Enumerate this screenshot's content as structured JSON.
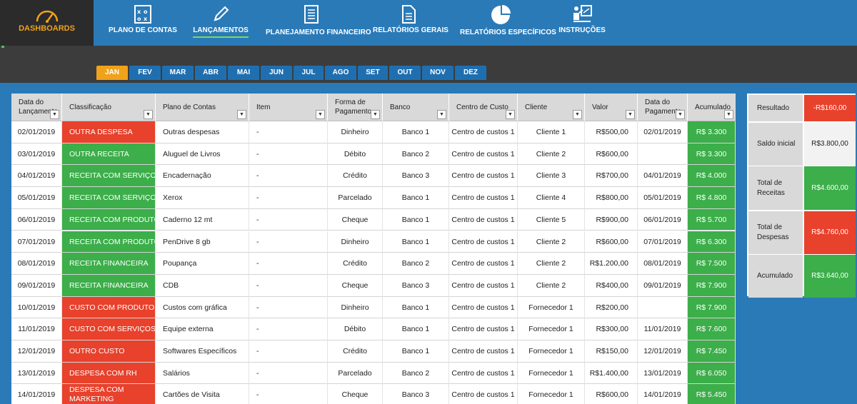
{
  "nav": {
    "dashboards": "DASHBOARDS",
    "items": [
      {
        "label": "PLANO DE CONTAS",
        "icon": "chalkboard-icon"
      },
      {
        "label": "LANÇAMENTOS",
        "icon": "pencil-icon"
      },
      {
        "label": "PLANEJAMENTO FINANCEIRO",
        "icon": "checklist-icon"
      },
      {
        "label": "RELATÓRIOS GERAIS",
        "icon": "document-icon"
      },
      {
        "label": "RELATÓRIOS ESPECÍFICOS",
        "icon": "pie-chart-icon"
      },
      {
        "label": "INSTRUÇÕES",
        "icon": "presenter-icon"
      }
    ],
    "active": "LANÇAMENTOS"
  },
  "months": [
    "JAN",
    "FEV",
    "MAR",
    "ABR",
    "MAI",
    "JUN",
    "JUL",
    "AGO",
    "SET",
    "OUT",
    "NOV",
    "DEZ"
  ],
  "active_month": "JAN",
  "table": {
    "headers": [
      "Data do Lançamento",
      "Classificação",
      "Plano de Contas",
      "Item",
      "Forma de Pagamento",
      "Banco",
      "Centro de Custo",
      "Cliente",
      "Valor",
      "Data do Pagamento",
      "Acumulado"
    ],
    "rows": [
      {
        "data": "02/01/2019",
        "classificacao": "OUTRA DESPESA",
        "tipo": "despesa",
        "plano": "Outras despesas",
        "item": "-",
        "forma": "Dinheiro",
        "banco": "Banco 1",
        "centro": "Centro de custos 1",
        "cliente": "Cliente 1",
        "valor": "R$500,00",
        "pagamento": "02/01/2019",
        "acumulado": "R$ 3.300"
      },
      {
        "data": "03/01/2019",
        "classificacao": "OUTRA RECEITA",
        "tipo": "receita",
        "plano": "Aluguel de Livros",
        "item": "-",
        "forma": "Débito",
        "banco": "Banco 2",
        "centro": "Centro de custos 1",
        "cliente": "Cliente 2",
        "valor": "R$600,00",
        "pagamento": "",
        "acumulado": "R$ 3.300"
      },
      {
        "data": "04/01/2019",
        "classificacao": "RECEITA COM SERVIÇOS",
        "tipo": "receita",
        "plano": "Encadernação",
        "item": "-",
        "forma": "Crédito",
        "banco": "Banco 3",
        "centro": "Centro de custos 1",
        "cliente": "Cliente 3",
        "valor": "R$700,00",
        "pagamento": "04/01/2019",
        "acumulado": "R$ 4.000"
      },
      {
        "data": "05/01/2019",
        "classificacao": "RECEITA COM SERVIÇOS",
        "tipo": "receita",
        "plano": "Xerox",
        "item": "-",
        "forma": "Parcelado",
        "banco": "Banco 1",
        "centro": "Centro de custos 1",
        "cliente": "Cliente 4",
        "valor": "R$800,00",
        "pagamento": "05/01/2019",
        "acumulado": "R$ 4.800"
      },
      {
        "data": "06/01/2019",
        "classificacao": "RECEITA COM PRODUTOS",
        "tipo": "receita",
        "plano": "Caderno 12 mt",
        "item": "-",
        "forma": "Cheque",
        "banco": "Banco 1",
        "centro": "Centro de custos 1",
        "cliente": "Cliente 5",
        "valor": "R$900,00",
        "pagamento": "06/01/2019",
        "acumulado": "R$ 5.700"
      },
      {
        "data": "07/01/2019",
        "classificacao": "RECEITA COM PRODUTOS",
        "tipo": "receita",
        "plano": "PenDrive 8 gb",
        "item": "-",
        "forma": "Dinheiro",
        "banco": "Banco 1",
        "centro": "Centro de custos 1",
        "cliente": "Cliente 2",
        "valor": "R$600,00",
        "pagamento": "07/01/2019",
        "acumulado": "R$ 6.300"
      },
      {
        "data": "08/01/2019",
        "classificacao": "RECEITA FINANCEIRA",
        "tipo": "receita",
        "plano": "Poupança",
        "item": "-",
        "forma": "Crédito",
        "banco": "Banco 2",
        "centro": "Centro de custos 1",
        "cliente": "Cliente 2",
        "valor": "R$1.200,00",
        "pagamento": "08/01/2019",
        "acumulado": "R$ 7.500"
      },
      {
        "data": "09/01/2019",
        "classificacao": "RECEITA FINANCEIRA",
        "tipo": "receita",
        "plano": "CDB",
        "item": "-",
        "forma": "Cheque",
        "banco": "Banco 3",
        "centro": "Centro de custos 1",
        "cliente": "Cliente 2",
        "valor": "R$400,00",
        "pagamento": "09/01/2019",
        "acumulado": "R$ 7.900"
      },
      {
        "data": "10/01/2019",
        "classificacao": "CUSTO COM PRODUTOS",
        "tipo": "despesa",
        "plano": "Custos com gráfica",
        "item": "-",
        "forma": "Dinheiro",
        "banco": "Banco 1",
        "centro": "Centro de custos 1",
        "cliente": "Fornecedor 1",
        "valor": "R$200,00",
        "pagamento": "",
        "acumulado": "R$ 7.900"
      },
      {
        "data": "11/01/2019",
        "classificacao": "CUSTO COM SERVIÇOS",
        "tipo": "despesa",
        "plano": "Equipe externa",
        "item": "-",
        "forma": "Débito",
        "banco": "Banco 1",
        "centro": "Centro de custos 1",
        "cliente": "Fornecedor 1",
        "valor": "R$300,00",
        "pagamento": "11/01/2019",
        "acumulado": "R$ 7.600"
      },
      {
        "data": "12/01/2019",
        "classificacao": "OUTRO CUSTO",
        "tipo": "despesa",
        "plano": "Softwares Específicos",
        "item": "-",
        "forma": "Crédito",
        "banco": "Banco 1",
        "centro": "Centro de custos 1",
        "cliente": "Fornecedor 1",
        "valor": "R$150,00",
        "pagamento": "12/01/2019",
        "acumulado": "R$ 7.450"
      },
      {
        "data": "13/01/2019",
        "classificacao": "DESPESA COM RH",
        "tipo": "despesa",
        "plano": "Salários",
        "item": "-",
        "forma": "Parcelado",
        "banco": "Banco 2",
        "centro": "Centro de custos 1",
        "cliente": "Fornecedor 1",
        "valor": "R$1.400,00",
        "pagamento": "13/01/2019",
        "acumulado": "R$ 6.050"
      },
      {
        "data": "14/01/2019",
        "classificacao": "DESPESA COM MARKETING",
        "tipo": "despesa",
        "plano": "Cartões de Visita",
        "item": "-",
        "forma": "Cheque",
        "banco": "Banco 3",
        "centro": "Centro de custos 1",
        "cliente": "Fornecedor 1",
        "valor": "R$600,00",
        "pagamento": "14/01/2019",
        "acumulado": "R$ 5.450"
      }
    ]
  },
  "summary": [
    {
      "label": "Resultado",
      "value": "-R$160,00",
      "color": "#e8412c",
      "text": "#ffffff"
    },
    {
      "label": "Saldo inicial",
      "value": "R$3.800,00",
      "color": "#f2f2f2",
      "text": "#222222"
    },
    {
      "label": "Total de Receitas",
      "value": "R$4.600,00",
      "color": "#3cae4a",
      "text": "#ffffff"
    },
    {
      "label": "Total de Despesas",
      "value": "R$4.760,00",
      "color": "#e8412c",
      "text": "#ffffff"
    },
    {
      "label": "Acumulado",
      "value": "R$3.640,00",
      "color": "#3cae4a",
      "text": "#ffffff"
    }
  ],
  "colors": {
    "receita": "#3cae4a",
    "despesa": "#e8412c",
    "accent": "#f0a21b",
    "nav": "#2a7ab8"
  }
}
